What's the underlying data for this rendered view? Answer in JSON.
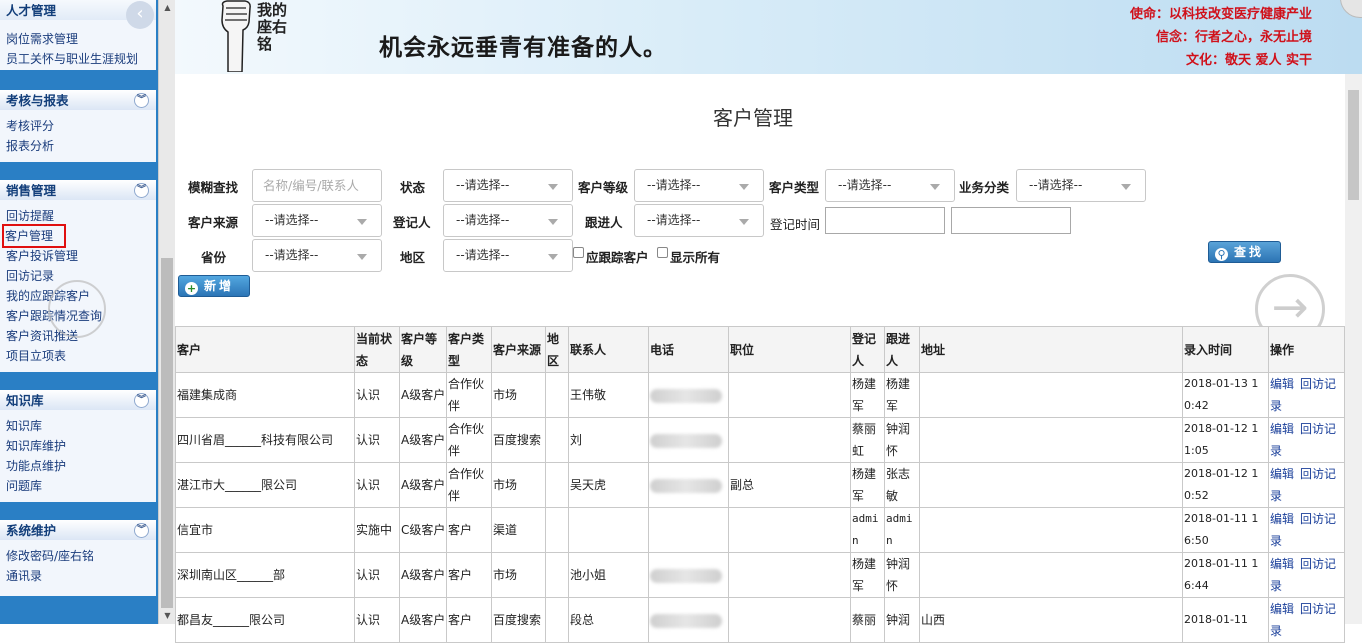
{
  "sidebar": {
    "sections": [
      {
        "title": "人才管理",
        "items": [
          "岗位需求管理",
          "员工关怀与职业生涯规划"
        ]
      },
      {
        "title": "考核与报表",
        "items": [
          "考核评分",
          "报表分析"
        ]
      },
      {
        "title": "销售管理",
        "items": [
          "回访提醒",
          "客户管理",
          "客户投诉管理",
          "回访记录",
          "我的应跟踪客户",
          "客户跟踪情况查询",
          "客户资讯推送",
          "项目立项表"
        ],
        "active": "客户管理"
      },
      {
        "title": "知识库",
        "items": [
          "知识库",
          "知识库维护",
          "功能点维护",
          "问题库"
        ]
      },
      {
        "title": "系统维护",
        "items": [
          "修改密码/座右铭",
          "通讯录"
        ]
      }
    ]
  },
  "banner": {
    "motto": "我的座右铭",
    "slogan": "机会永远垂青有准备的人。",
    "mission": "使命：以科技改变医疗健康产业",
    "belief": "信念：行者之心，永无止境",
    "culture": "文化：敬天  爱人  实干"
  },
  "page": {
    "title": "客户管理"
  },
  "filters": {
    "fuzzy_label": "模糊查找",
    "fuzzy_placeholder": "名称/编号/联系人",
    "status_label": "状态",
    "level_label": "客户等级",
    "type_label": "客户类型",
    "biz_label": "业务分类",
    "source_label": "客户来源",
    "registrar_label": "登记人",
    "follower_label": "跟进人",
    "regtime_label": "登记时间",
    "province_label": "省份",
    "region_label": "地区",
    "select_default": "--请选择--",
    "should_follow_label": "应跟踪客户",
    "show_all_label": "显示所有",
    "search_button": "查找",
    "add_button": "新增"
  },
  "table": {
    "headers": [
      "客户",
      "当前状态",
      "客户等级",
      "客户类型",
      "客户来源",
      "地区",
      "联系人",
      "电话",
      "职位",
      "登记人",
      "跟进人",
      "地址",
      "录入时间",
      "操作"
    ],
    "rows": [
      {
        "customer": "福建集成商",
        "status": "认识",
        "level": "A级客户",
        "type": "合作伙伴",
        "source": "市场",
        "region": "",
        "contact": "王伟敬",
        "phone": "",
        "position": "",
        "registrar": "杨建军",
        "follower": "杨建军",
        "address": "",
        "time": "2018-01-13 10:42"
      },
      {
        "customer": "四川省眉______科技有限公司",
        "status": "认识",
        "level": "A级客户",
        "type": "合作伙伴",
        "source": "百度搜索",
        "region": "",
        "contact": "刘",
        "phone": "",
        "position": "",
        "registrar": "蔡丽虹",
        "follower": "钟润怀",
        "address": "",
        "time": "2018-01-12 11:05"
      },
      {
        "customer": "湛江市大______限公司",
        "status": "认识",
        "level": "A级客户",
        "type": "合作伙伴",
        "source": "市场",
        "region": "",
        "contact": "吴天虎",
        "phone": "",
        "position": "副总",
        "registrar": "杨建军",
        "follower": "张志敏",
        "address": "",
        "time": "2018-01-12 10:52"
      },
      {
        "customer": "信宜市",
        "status": "实施中",
        "level": "C级客户",
        "type": "客户",
        "source": "渠道",
        "region": "",
        "contact": "",
        "phone": "",
        "position": "",
        "registrar": "admin",
        "follower": "admin",
        "address": "",
        "time": "2018-01-11 16:50"
      },
      {
        "customer": "深圳南山区______部",
        "status": "认识",
        "level": "A级客户",
        "type": "客户",
        "source": "市场",
        "region": "",
        "contact": "池小姐",
        "phone": "",
        "position": "",
        "registrar": "杨建军",
        "follower": "钟润怀",
        "address": "",
        "time": "2018-01-11 16:44"
      },
      {
        "customer": "都昌友______限公司",
        "status": "认识",
        "level": "A级客户",
        "type": "客户",
        "source": "百度搜索",
        "region": "",
        "contact": "段总",
        "phone": "",
        "position": "",
        "registrar": "蔡丽",
        "follower": "钟润",
        "address": "山西",
        "time": "2018-01-11"
      }
    ],
    "actions": {
      "edit": "编辑",
      "visit": "回访记录"
    }
  }
}
